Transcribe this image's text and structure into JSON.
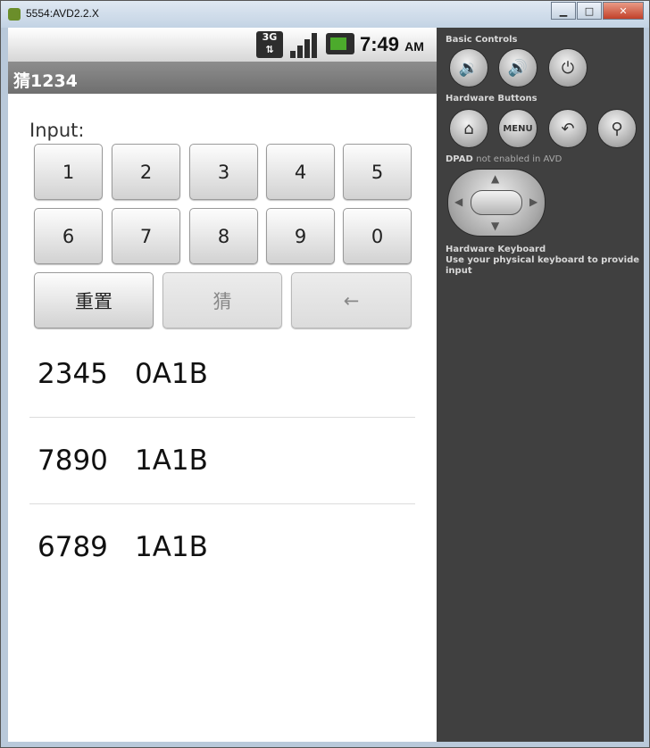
{
  "window": {
    "title": "5554:AVD2.2.X",
    "controls": {
      "minimize": "▁",
      "maximize": "□",
      "close": "✕"
    }
  },
  "statusbar": {
    "network": "3G",
    "time": "7:49",
    "ampm": "AM"
  },
  "app": {
    "title": "猜1234",
    "input_label": "Input:",
    "digit_buttons": [
      "1",
      "2",
      "3",
      "4",
      "5",
      "6",
      "7",
      "8",
      "9",
      "0"
    ],
    "reset_label": "重置",
    "guess_label": "猜",
    "backspace_label": "←"
  },
  "history": [
    {
      "guess": "2345",
      "result": "0A1B"
    },
    {
      "guess": "7890",
      "result": "1A1B"
    },
    {
      "guess": "6789",
      "result": "1A1B"
    }
  ],
  "panel": {
    "basic_controls": "Basic Controls",
    "hardware_buttons": "Hardware Buttons",
    "menu_label": "MENU",
    "dpad_label": "DPAD",
    "dpad_note": "not enabled in AVD",
    "keyboard_title": "Hardware Keyboard",
    "keyboard_note": "Use your physical keyboard to provide input"
  }
}
